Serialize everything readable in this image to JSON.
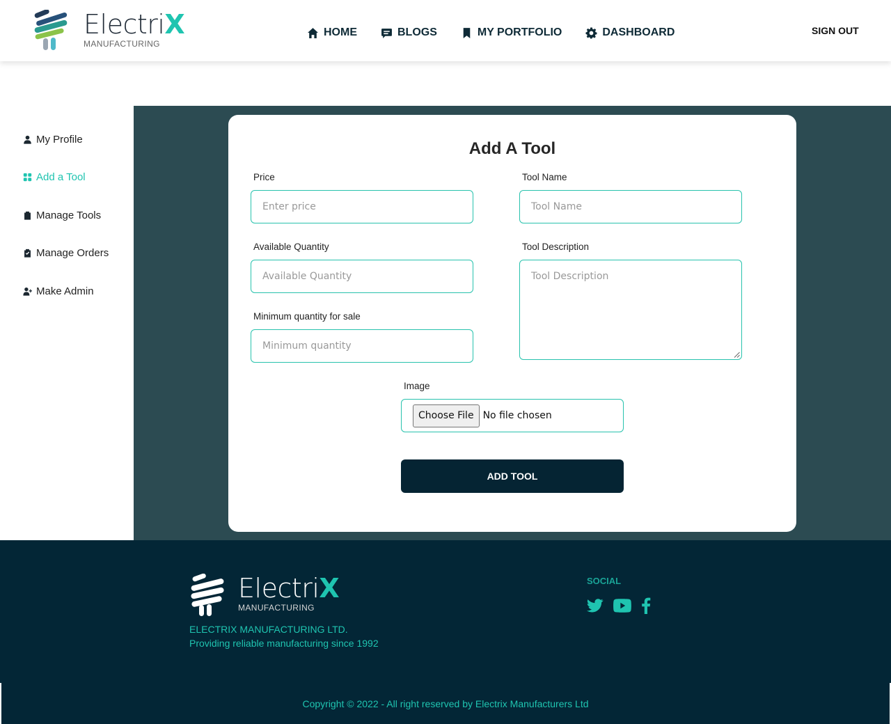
{
  "brand": {
    "name_main": "Electri",
    "name_accent": "X",
    "tagline": "MANUFACTURING",
    "accent_color": "#1fc4b0",
    "dark_color": "#052433"
  },
  "nav": {
    "items": [
      {
        "label": "HOME",
        "icon": "home-icon"
      },
      {
        "label": "BLOGS",
        "icon": "comment-icon"
      },
      {
        "label": "MY PORTFOLIO",
        "icon": "bookmark-icon"
      },
      {
        "label": "DASHBOARD",
        "icon": "gear-icon"
      }
    ],
    "sign_out": "SIGN OUT"
  },
  "sidebar": {
    "items": [
      {
        "label": "My Profile",
        "icon": "user-icon",
        "active": false
      },
      {
        "label": "Add a Tool",
        "icon": "grid-icon",
        "active": true
      },
      {
        "label": "Manage Tools",
        "icon": "clipboard-icon",
        "active": false
      },
      {
        "label": "Manage Orders",
        "icon": "clipboard-check-icon",
        "active": false
      },
      {
        "label": "Make Admin",
        "icon": "user-plus-icon",
        "active": false
      }
    ]
  },
  "form": {
    "title": "Add A Tool",
    "price": {
      "label": "Price",
      "placeholder": "Enter price"
    },
    "tool_name": {
      "label": "Tool Name",
      "placeholder": "Tool Name"
    },
    "available_quantity": {
      "label": "Available Quantity",
      "placeholder": "Available Quantity"
    },
    "tool_description": {
      "label": "Tool Description",
      "placeholder": "Tool Description"
    },
    "minimum_quantity": {
      "label": "Minimum quantity for sale",
      "placeholder": "Minimum quantity"
    },
    "image": {
      "label": "Image",
      "button": "Choose File",
      "status": "No file chosen"
    },
    "submit": "ADD TOOL"
  },
  "footer": {
    "company_name": "ELECTRIX MANUFACTURING LTD.",
    "company_tagline": "Providing reliable manufacturing since 1992",
    "social_title": "SOCIAL",
    "social_icons": [
      "twitter-icon",
      "youtube-icon",
      "facebook-icon"
    ],
    "copyright": "Copyright © 2022 - All right reserved by Electrix Manufacturers Ltd"
  }
}
